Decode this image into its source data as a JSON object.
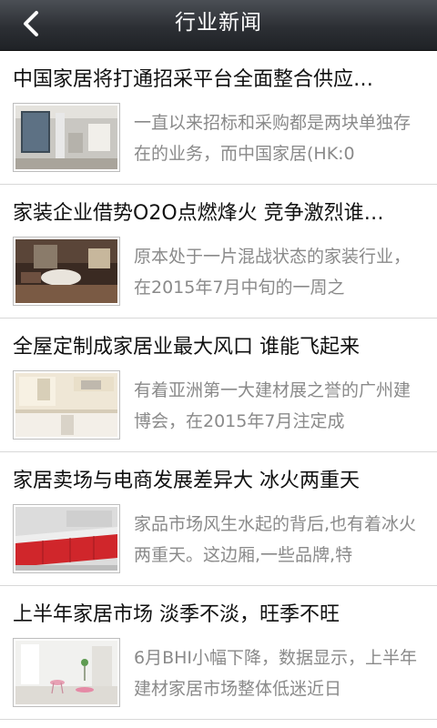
{
  "header": {
    "title": "行业新闻",
    "back_icon": "chevron-left-icon"
  },
  "news": [
    {
      "title": "中国家居将打通招采平台全面整合供应…",
      "summary": "一直以来招标和采购都是两块单独存在的业务，而中国家居(HK:0"
    },
    {
      "title": "家装企业借势O2O点燃烽火 竞争激烈谁…",
      "summary": "原本处于一片混战状态的家装行业，在2015年7月中旬的一周之"
    },
    {
      "title": "全屋定制成家居业最大风口 谁能飞起来",
      "summary": "有着亚洲第一大建材展之誉的广州建博会，在2015年7月注定成"
    },
    {
      "title": "家居卖场与电商发展差异大 冰火两重天",
      "summary": "家品市场风生水起的背后,也有着冰火两重天。这边厢,一些品牌,特"
    },
    {
      "title": "上半年家居市场 淡季不淡，旺季不旺",
      "summary": "6月BHI小幅下降，数据显示，上半年建材家居市场整体低迷近日"
    }
  ]
}
